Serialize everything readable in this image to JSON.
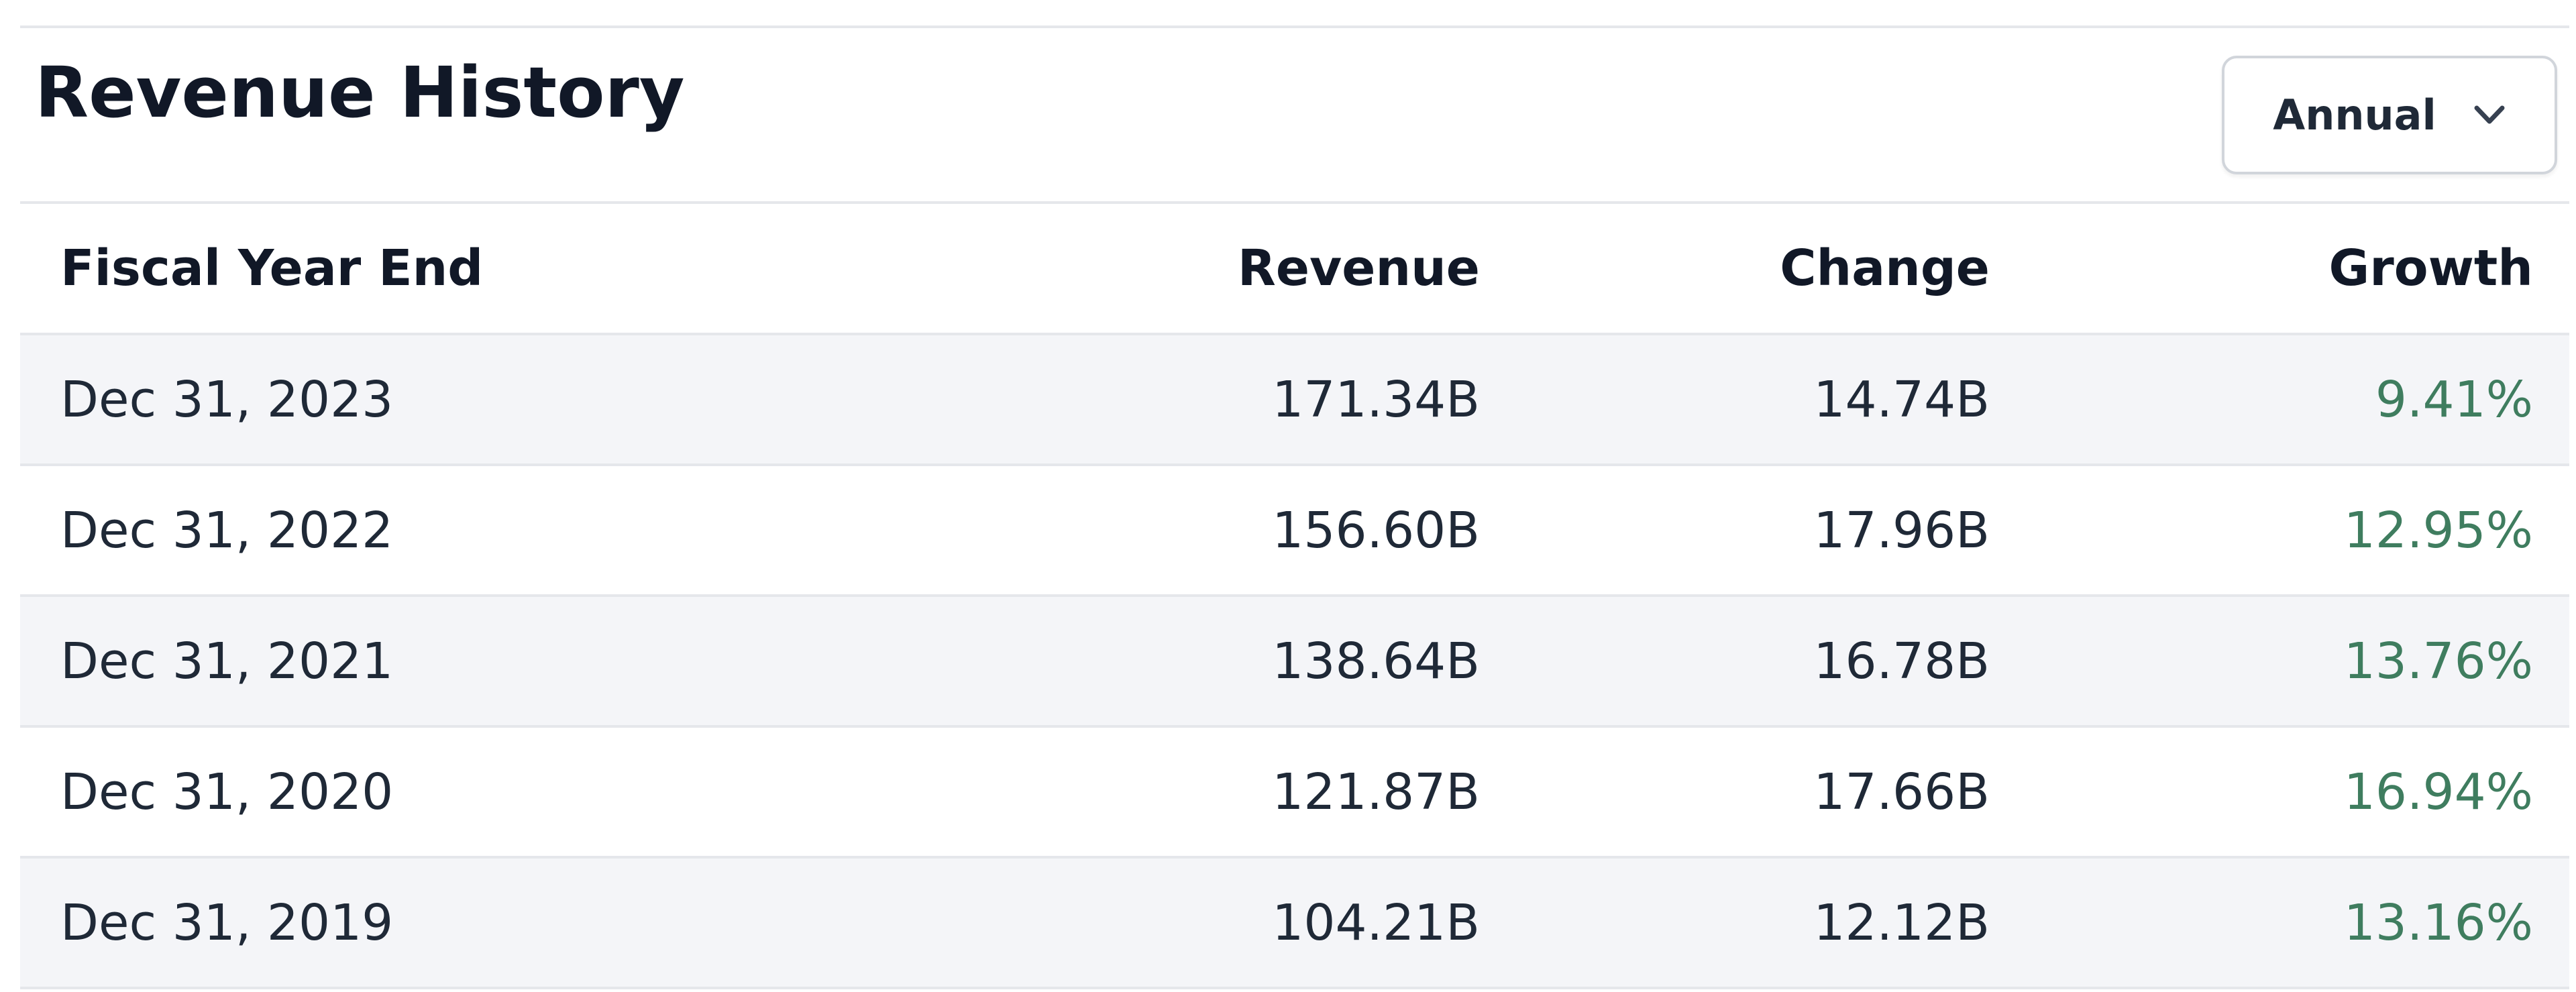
{
  "section": {
    "title": "Revenue History"
  },
  "period_select": {
    "selected": "Annual"
  },
  "table": {
    "headers": {
      "date": "Fiscal Year End",
      "revenue": "Revenue",
      "change": "Change",
      "growth": "Growth"
    },
    "rows": [
      {
        "date": "Dec 31, 2023",
        "revenue": "171.34B",
        "change": "14.74B",
        "growth": "9.41%"
      },
      {
        "date": "Dec 31, 2022",
        "revenue": "156.60B",
        "change": "17.96B",
        "growth": "12.95%"
      },
      {
        "date": "Dec 31, 2021",
        "revenue": "138.64B",
        "change": "16.78B",
        "growth": "13.76%"
      },
      {
        "date": "Dec 31, 2020",
        "revenue": "121.87B",
        "change": "17.66B",
        "growth": "16.94%"
      },
      {
        "date": "Dec 31, 2019",
        "revenue": "104.21B",
        "change": "12.12B",
        "growth": "13.16%"
      }
    ]
  },
  "colors": {
    "growth_positive": "#3f7d5f",
    "row_stripe": "#f4f5f8",
    "border": "#e5e7eb"
  },
  "icons": {
    "period_select": "chevron-down-icon"
  }
}
